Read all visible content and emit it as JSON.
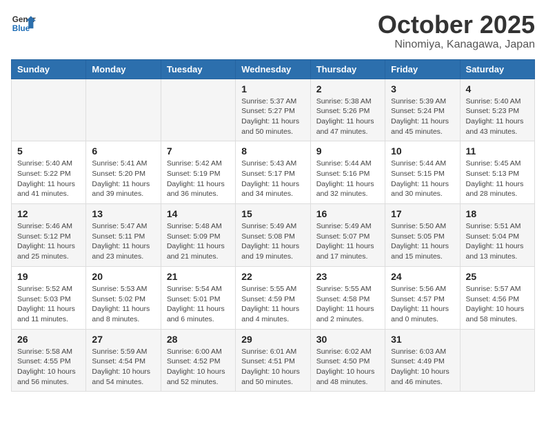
{
  "logo": {
    "line1": "General",
    "line2": "Blue"
  },
  "title": "October 2025",
  "subtitle": "Ninomiya, Kanagawa, Japan",
  "headers": [
    "Sunday",
    "Monday",
    "Tuesday",
    "Wednesday",
    "Thursday",
    "Friday",
    "Saturday"
  ],
  "weeks": [
    [
      {
        "day": "",
        "info": ""
      },
      {
        "day": "",
        "info": ""
      },
      {
        "day": "",
        "info": ""
      },
      {
        "day": "1",
        "info": "Sunrise: 5:37 AM\nSunset: 5:27 PM\nDaylight: 11 hours\nand 50 minutes."
      },
      {
        "day": "2",
        "info": "Sunrise: 5:38 AM\nSunset: 5:26 PM\nDaylight: 11 hours\nand 47 minutes."
      },
      {
        "day": "3",
        "info": "Sunrise: 5:39 AM\nSunset: 5:24 PM\nDaylight: 11 hours\nand 45 minutes."
      },
      {
        "day": "4",
        "info": "Sunrise: 5:40 AM\nSunset: 5:23 PM\nDaylight: 11 hours\nand 43 minutes."
      }
    ],
    [
      {
        "day": "5",
        "info": "Sunrise: 5:40 AM\nSunset: 5:22 PM\nDaylight: 11 hours\nand 41 minutes."
      },
      {
        "day": "6",
        "info": "Sunrise: 5:41 AM\nSunset: 5:20 PM\nDaylight: 11 hours\nand 39 minutes."
      },
      {
        "day": "7",
        "info": "Sunrise: 5:42 AM\nSunset: 5:19 PM\nDaylight: 11 hours\nand 36 minutes."
      },
      {
        "day": "8",
        "info": "Sunrise: 5:43 AM\nSunset: 5:17 PM\nDaylight: 11 hours\nand 34 minutes."
      },
      {
        "day": "9",
        "info": "Sunrise: 5:44 AM\nSunset: 5:16 PM\nDaylight: 11 hours\nand 32 minutes."
      },
      {
        "day": "10",
        "info": "Sunrise: 5:44 AM\nSunset: 5:15 PM\nDaylight: 11 hours\nand 30 minutes."
      },
      {
        "day": "11",
        "info": "Sunrise: 5:45 AM\nSunset: 5:13 PM\nDaylight: 11 hours\nand 28 minutes."
      }
    ],
    [
      {
        "day": "12",
        "info": "Sunrise: 5:46 AM\nSunset: 5:12 PM\nDaylight: 11 hours\nand 25 minutes."
      },
      {
        "day": "13",
        "info": "Sunrise: 5:47 AM\nSunset: 5:11 PM\nDaylight: 11 hours\nand 23 minutes."
      },
      {
        "day": "14",
        "info": "Sunrise: 5:48 AM\nSunset: 5:09 PM\nDaylight: 11 hours\nand 21 minutes."
      },
      {
        "day": "15",
        "info": "Sunrise: 5:49 AM\nSunset: 5:08 PM\nDaylight: 11 hours\nand 19 minutes."
      },
      {
        "day": "16",
        "info": "Sunrise: 5:49 AM\nSunset: 5:07 PM\nDaylight: 11 hours\nand 17 minutes."
      },
      {
        "day": "17",
        "info": "Sunrise: 5:50 AM\nSunset: 5:05 PM\nDaylight: 11 hours\nand 15 minutes."
      },
      {
        "day": "18",
        "info": "Sunrise: 5:51 AM\nSunset: 5:04 PM\nDaylight: 11 hours\nand 13 minutes."
      }
    ],
    [
      {
        "day": "19",
        "info": "Sunrise: 5:52 AM\nSunset: 5:03 PM\nDaylight: 11 hours\nand 11 minutes."
      },
      {
        "day": "20",
        "info": "Sunrise: 5:53 AM\nSunset: 5:02 PM\nDaylight: 11 hours\nand 8 minutes."
      },
      {
        "day": "21",
        "info": "Sunrise: 5:54 AM\nSunset: 5:01 PM\nDaylight: 11 hours\nand 6 minutes."
      },
      {
        "day": "22",
        "info": "Sunrise: 5:55 AM\nSunset: 4:59 PM\nDaylight: 11 hours\nand 4 minutes."
      },
      {
        "day": "23",
        "info": "Sunrise: 5:55 AM\nSunset: 4:58 PM\nDaylight: 11 hours\nand 2 minutes."
      },
      {
        "day": "24",
        "info": "Sunrise: 5:56 AM\nSunset: 4:57 PM\nDaylight: 11 hours\nand 0 minutes."
      },
      {
        "day": "25",
        "info": "Sunrise: 5:57 AM\nSunset: 4:56 PM\nDaylight: 10 hours\nand 58 minutes."
      }
    ],
    [
      {
        "day": "26",
        "info": "Sunrise: 5:58 AM\nSunset: 4:55 PM\nDaylight: 10 hours\nand 56 minutes."
      },
      {
        "day": "27",
        "info": "Sunrise: 5:59 AM\nSunset: 4:54 PM\nDaylight: 10 hours\nand 54 minutes."
      },
      {
        "day": "28",
        "info": "Sunrise: 6:00 AM\nSunset: 4:52 PM\nDaylight: 10 hours\nand 52 minutes."
      },
      {
        "day": "29",
        "info": "Sunrise: 6:01 AM\nSunset: 4:51 PM\nDaylight: 10 hours\nand 50 minutes."
      },
      {
        "day": "30",
        "info": "Sunrise: 6:02 AM\nSunset: 4:50 PM\nDaylight: 10 hours\nand 48 minutes."
      },
      {
        "day": "31",
        "info": "Sunrise: 6:03 AM\nSunset: 4:49 PM\nDaylight: 10 hours\nand 46 minutes."
      },
      {
        "day": "",
        "info": ""
      }
    ]
  ]
}
